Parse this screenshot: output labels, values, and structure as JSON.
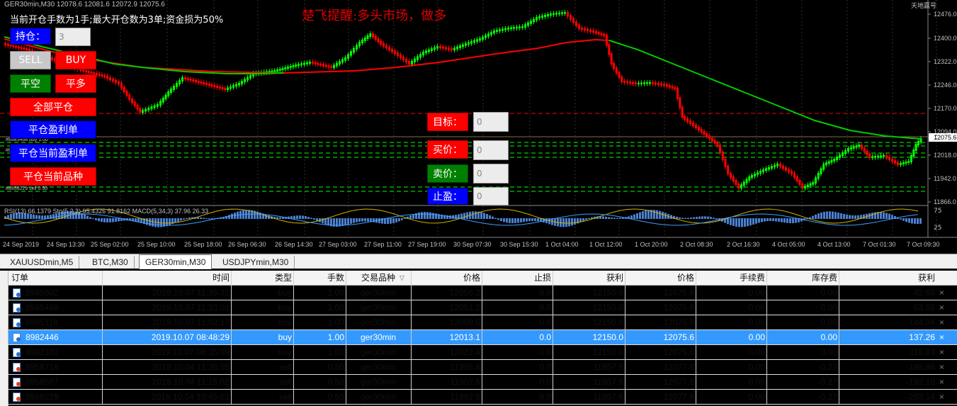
{
  "chart": {
    "header": "GER30min,M30  12078.6 12081.6 12072.9 12075.6",
    "info_text": "当前开仓手数为1手;最大开仓数为3单;资金损为50%",
    "alert_text": "楚飞提醒:多头市场，做多",
    "corner_text": "天地赢号",
    "price_axis": [
      "12476.0",
      "12400.0",
      "12322.0",
      "12246.0",
      "12170.0",
      "12094.0",
      "12075.6",
      "12018.0",
      "11942.0",
      "11866.0"
    ],
    "current_price": "12075.6",
    "indicator_label": "RSI(13) 66.1379  Sto(5,2,3) 95.4326 91.8162  MACD(5,34,3) 37.96 26.33",
    "indicator_axis": [
      "75",
      "25"
    ],
    "time_axis": [
      "24 Sep 2019",
      "24 Sep 13:30",
      "25 Sep 02:00",
      "25 Sep 10:00",
      "25 Sep 18:00",
      "26 Sep 06:30",
      "26 Sep 14:30",
      "27 Sep 03:00",
      "27 Sep 11:00",
      "27 Sep 19:00",
      "30 Sep 07:30",
      "30 Sep 15:30",
      "1 Oct 04:00",
      "1 Oct 12:00",
      "1 Oct 20:00",
      "2 Oct 08:30",
      "2 Oct 16:30",
      "4 Oct 05:00",
      "4 Oct 13:00",
      "7 Oct 01:30",
      "7 Oct 09:30"
    ],
    "line_labels": [
      "#8985468 buy 1.00",
      "#8982446 buy 1.00",
      "#8958229 sell 0.50"
    ]
  },
  "panel": {
    "hold_label": "持仓：",
    "hold_value": "3",
    "sell": "SELL",
    "buy": "BUY",
    "close_short": "平空",
    "close_long": "平多",
    "close_all": "全部平仓",
    "close_profit": "平仓盈利单",
    "close_current_profit": "平仓当前盈利单",
    "close_current_symbol": "平仓当前品种",
    "target_label": "目标：",
    "target_value": "0",
    "buy_price_label": "买价：",
    "buy_price_value": "0",
    "sell_price_label": "卖价：",
    "sell_price_value": "0",
    "take_profit_label": "止盈：",
    "take_profit_value": "0"
  },
  "tabs": [
    "XAUUSDmin,M5",
    "BTC,M30",
    "GER30min,M30",
    "USDJPYmin,M30"
  ],
  "active_tab": 2,
  "table": {
    "headers": [
      "订单",
      "时间",
      "类型",
      "手数",
      "交易品种",
      "价格",
      "止损",
      "获利",
      "价格",
      "手续费",
      "库存费",
      "获利"
    ],
    "rows": [
      [
        "8985502",
        "2019.10.07 11:35:31",
        "buy",
        "1.00",
        "ger30min",
        "12056.2",
        "0.0",
        "12150.0",
        "12075.6",
        "0.00",
        "0.00",
        "42.60"
      ],
      [
        "8985468",
        "2019.10.07 11:33:01",
        "buy",
        "1.00",
        "ger30min",
        "12051.2",
        "0.0",
        "12150.0",
        "12075.6",
        "0.00",
        "0.00",
        "53.58"
      ],
      [
        "8985118",
        "2019.10.07 11:02:17",
        "buy",
        "1.00",
        "ger30min",
        "12009.6",
        "0.0",
        "12150.0",
        "12075.6",
        "0.00",
        "0.00",
        "144.94"
      ],
      [
        "8982446",
        "2019.10.07 08:48:29",
        "buy",
        "1.00",
        "ger30min",
        "12013.1",
        "0.0",
        "12150.0",
        "12075.6",
        "0.00",
        "0.00",
        "137.26"
      ],
      [
        "8982102",
        "2019.10.07 08:35:09",
        "buy",
        "1.00",
        "ger30min",
        "12022.4",
        "0.0",
        "12150.0",
        "12075.6",
        "0.00",
        "0.00",
        "116.83"
      ],
      [
        "8958718",
        "2019.10.04 11:26:55",
        "sell",
        "0.50",
        "ger30min",
        "11905.6",
        "0.0",
        "11857.6",
        "12077.6",
        "0.00",
        "-0.27",
        "-188.86"
      ],
      [
        "8958597",
        "2019.10.04 11:15:02",
        "sell",
        "0.50",
        "ger30min",
        "11902.6",
        "0.0",
        "11857.6",
        "12077.6",
        "0.00",
        "-0.27",
        "-192.16"
      ],
      [
        "8958229",
        "2019.10.04 10:45:01",
        "sell",
        "0.50",
        "ger30min",
        "11892.6",
        "0.0",
        "11857.6",
        "12077.6",
        "0.00",
        "-0.27",
        "-203.14"
      ]
    ],
    "selected_row": 3,
    "close_glyph": "×"
  },
  "colors": {
    "bull": "#00ff00",
    "bear": "#ff0000",
    "ma_slow": "#00cc00",
    "ma_fast": "#ff0000",
    "grid": "#303030",
    "axis_text": "#c0c0c0",
    "level_lines": "#00ff00",
    "target_line": "#ff0000"
  }
}
